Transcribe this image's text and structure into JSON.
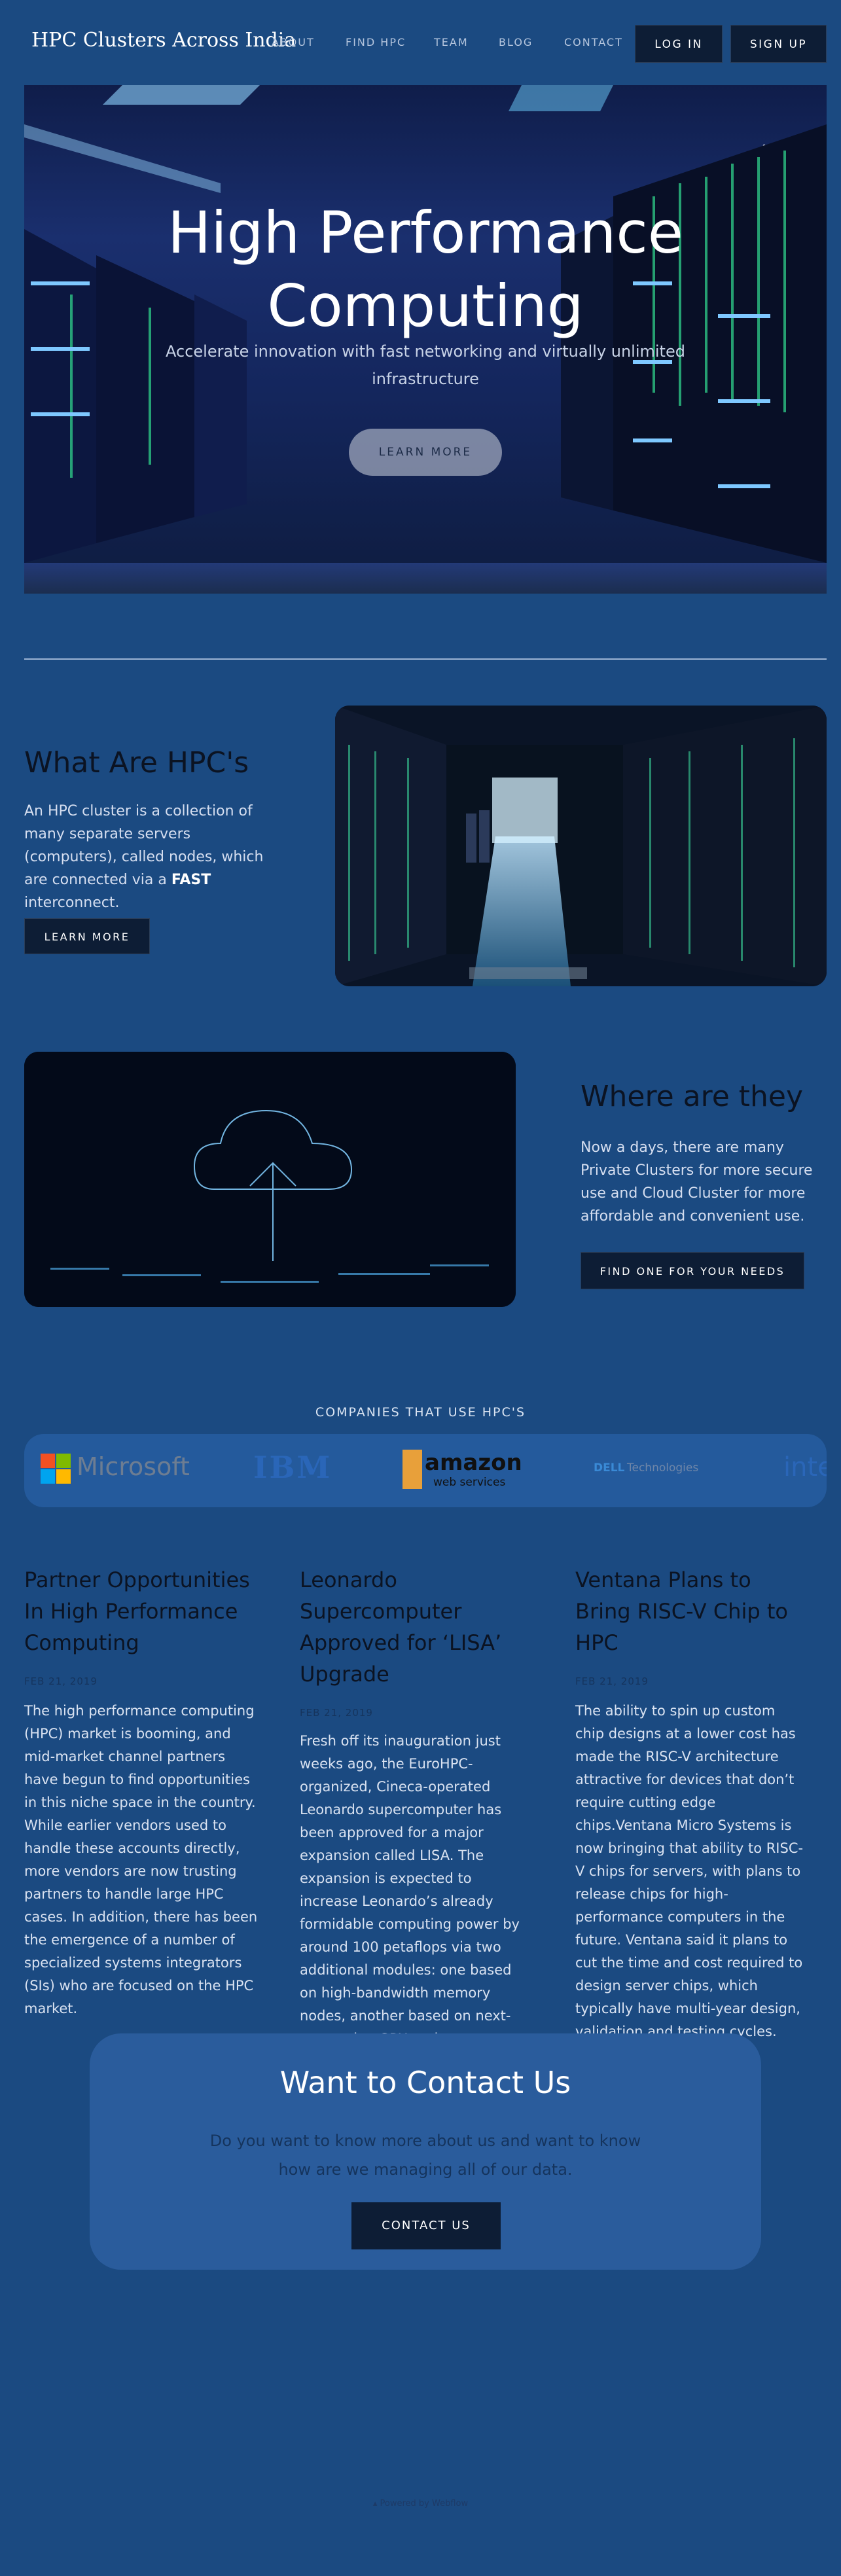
{
  "header": {
    "brand": "HPC Clusters Across India",
    "nav": [
      "ABOUT",
      "FIND HPC",
      "TEAM",
      "BLOG",
      "CONTACT"
    ],
    "login": "LOG IN",
    "signup": "SIGN UP"
  },
  "hero": {
    "title_line1": "High Performance",
    "title_line2": "Computing",
    "subtitle": "Accelerate innovation with fast networking and virtually unlimited infrastructure",
    "button": "LEARN MORE"
  },
  "what": {
    "title": "What Are HPC's",
    "text_before": "An HPC cluster is a collection of many separate servers (computers), called nodes, which are connected via a ",
    "text_bold": "FAST",
    "text_after": " interconnect.",
    "button": "LEARN MORE"
  },
  "where": {
    "title": "Where are they",
    "text": "Now a days, there are many Private Clusters for more secure use and Cloud Cluster for more affordable and convenient use.",
    "button": "FIND ONE FOR YOUR NEEDS"
  },
  "companies": {
    "title": "COMPANIES THAT USE HPC'S",
    "logos": [
      "Microsoft",
      "IBM",
      "amazon",
      "web services",
      "DELL",
      "Technologies",
      "intel"
    ]
  },
  "news": [
    {
      "title": "Partner Opportunities In High Performance Computing",
      "date": "FEB 21, 2019",
      "text": "The high performance computing (HPC) market is booming, and mid-market channel partners have begun to find opportunities in this niche space in the country. While earlier vendors used to handle these accounts directly, more vendors are now trusting partners to handle large HPC cases. In addition, there has been the emergence of a number of specialized systems integrators (SIs) who are focused on the HPC market."
    },
    {
      "title": "Leonardo Supercomputer Approved for ‘LISA’ Upgrade",
      "date": "FEB 21, 2019",
      "text": "Fresh off its inauguration just weeks ago, the EuroHPC-organized, Cineca-operated Leonardo supercomputer has been approved for a major expansion called LISA. The expansion is expected to increase Leonardo’s already formidable computing power by around 100 petaflops via two additional modules: one based on high-bandwidth memory nodes, another based on next-generation GPU nodes."
    },
    {
      "title": "Ventana Plans to Bring RISC-V Chip to HPC",
      "date": "FEB 21, 2019",
      "text": "The ability to spin up custom chip designs at a lower cost has made the RISC-V architecture attractive for devices that don’t require cutting edge chips.Ventana Micro Systems is now bringing that ability to RISC-V chips for servers, with plans to release chips for high-performance computers in the future. Ventana said it plans to cut the time and cost required to design server chips, which typically have multi-year design, validation and testing cycles."
    }
  ],
  "contact": {
    "title": "Want to Contact Us",
    "subtitle": "Do you want to know more about us and want to know how are we managing all of our data.",
    "button": "CONTACT US"
  },
  "footer": {
    "text": "Powered by Webflow"
  }
}
